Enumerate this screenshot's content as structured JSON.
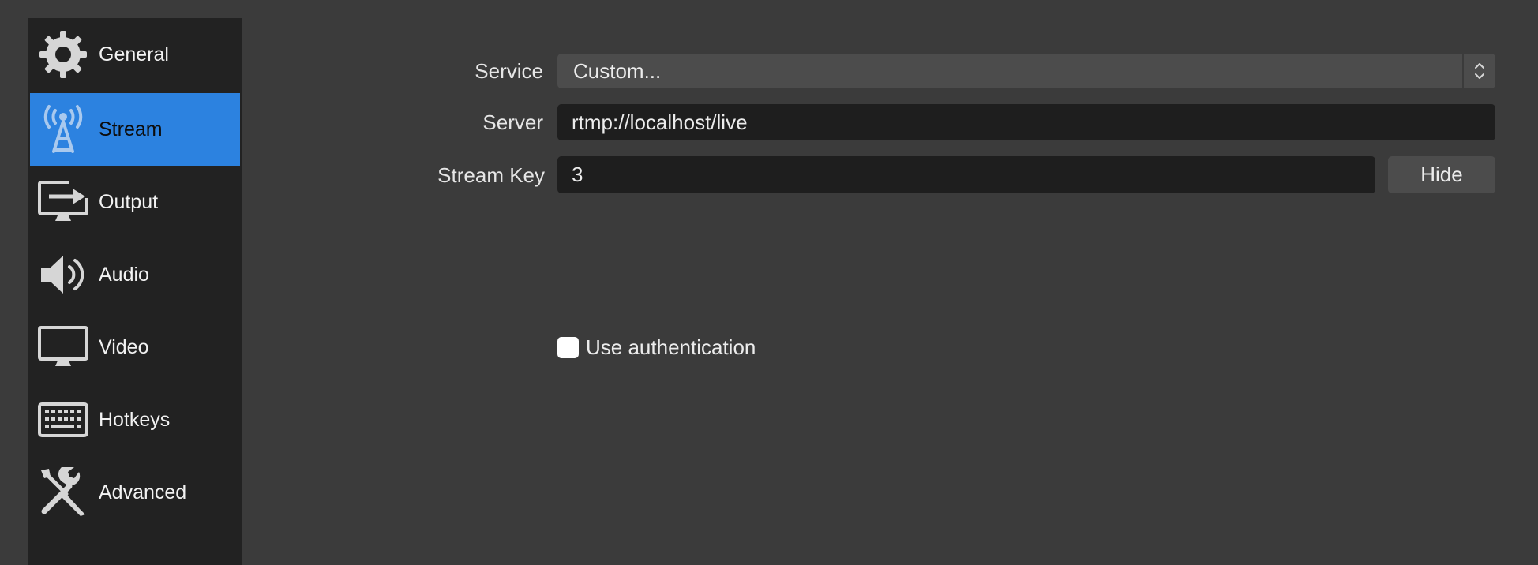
{
  "sidebar": {
    "items": [
      {
        "label": "General",
        "icon": "gear-icon",
        "active": false
      },
      {
        "label": "Stream",
        "icon": "broadcast-antenna-icon",
        "active": true
      },
      {
        "label": "Output",
        "icon": "output-monitor-icon",
        "active": false
      },
      {
        "label": "Audio",
        "icon": "speaker-icon",
        "active": false
      },
      {
        "label": "Video",
        "icon": "monitor-icon",
        "active": false
      },
      {
        "label": "Hotkeys",
        "icon": "keyboard-icon",
        "active": false
      },
      {
        "label": "Advanced",
        "icon": "tools-icon",
        "active": false
      }
    ]
  },
  "stream": {
    "service_label": "Service",
    "service_value": "Custom...",
    "server_label": "Server",
    "server_value": "rtmp://localhost/live",
    "stream_key_label": "Stream Key",
    "stream_key_value": "3",
    "hide_button": "Hide",
    "use_auth_label": "Use authentication",
    "use_auth_checked": false
  },
  "colors": {
    "background": "#3b3b3b",
    "sidebar": "#222222",
    "accent": "#2c82e0",
    "field": "#1e1e1e",
    "button": "#4c4c4c"
  }
}
